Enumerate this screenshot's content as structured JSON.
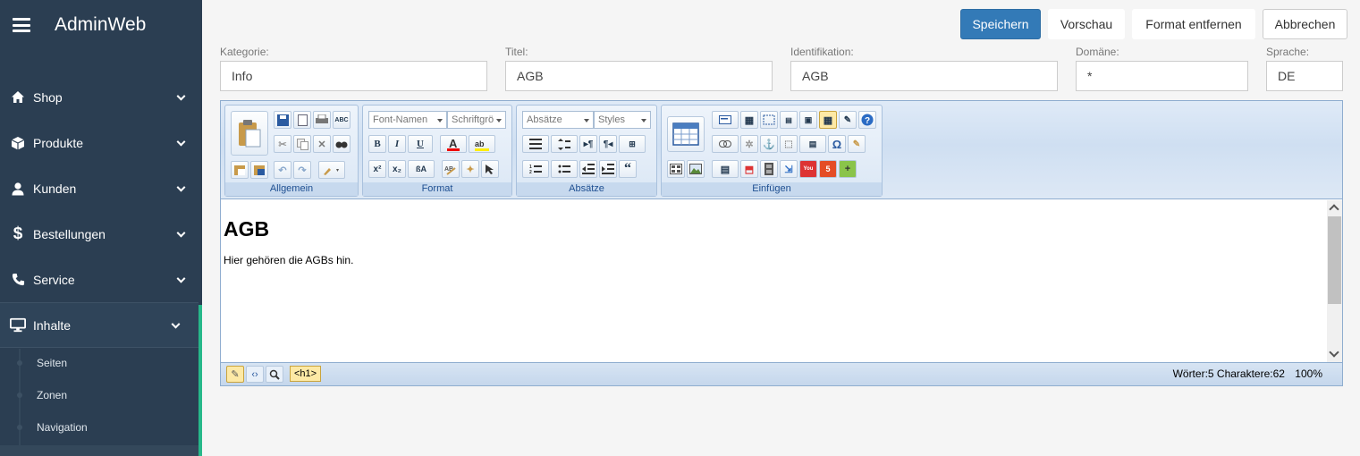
{
  "app": {
    "title": "AdminWeb"
  },
  "nav": {
    "items": [
      {
        "label": "Shop",
        "icon": "home-icon"
      },
      {
        "label": "Produkte",
        "icon": "cube-icon"
      },
      {
        "label": "Kunden",
        "icon": "user-icon"
      },
      {
        "label": "Bestellungen",
        "icon": "dollar-icon"
      },
      {
        "label": "Service",
        "icon": "phone-icon"
      },
      {
        "label": "Inhalte",
        "icon": "monitor-icon"
      }
    ],
    "sub_items": [
      {
        "label": "Seiten"
      },
      {
        "label": "Zonen"
      },
      {
        "label": "Navigation"
      }
    ]
  },
  "toolbar": {
    "save_label": "Speichern",
    "preview_label": "Vorschau",
    "strip_format_label": "Format entfernen",
    "cancel_label": "Abbrechen"
  },
  "form": {
    "kategorie": {
      "label": "Kategorie:",
      "value": "Info"
    },
    "titel": {
      "label": "Titel:",
      "value": "AGB"
    },
    "identifikation": {
      "label": "Identifikation:",
      "value": "AGB"
    },
    "domaene": {
      "label": "Domäne:",
      "value": "*"
    },
    "sprache": {
      "label": "Sprache:",
      "value": "DE"
    }
  },
  "editor": {
    "groups": {
      "allgemein": "Allgemein",
      "format": "Format",
      "absaetze": "Absätze",
      "einfuegen": "Einfügen"
    },
    "font_name": "Font-Namen",
    "font_size": "Schriftgrö",
    "paragraph": "Absätze",
    "styles": "Styles",
    "heading": "AGB",
    "body": "Hier gehören die AGBs hin.",
    "tag": "<h1>",
    "status": "Wörter:5 Charaktere:62",
    "zoom": "100%"
  },
  "colors": {
    "sidebar": "#2b3e52",
    "accent": "#27b88a",
    "primary": "#337ab7"
  }
}
